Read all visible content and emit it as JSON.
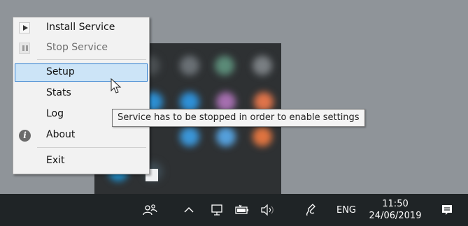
{
  "menu": {
    "items": [
      {
        "label": "Install Service",
        "icon": "play-icon",
        "enabled": true
      },
      {
        "label": "Stop Service",
        "icon": "pause-icon",
        "enabled": false
      },
      {
        "label": "Setup",
        "highlighted": true
      },
      {
        "label": "Stats"
      },
      {
        "label": "Log"
      },
      {
        "label": "About",
        "icon": "info-icon"
      },
      {
        "label": "Exit"
      }
    ]
  },
  "tooltip": {
    "text": "Service has to be stopped in order to enable settings"
  },
  "taskbar": {
    "icons": [
      "people-icon",
      "show-hidden-icons-chevron-icon",
      "network-icon",
      "battery-icon",
      "volume-icon",
      "pen-icon",
      "notification-icon"
    ],
    "language": "ENG",
    "time": "11:50",
    "date": "24/06/2019"
  },
  "colors": {
    "desktop": "#8f9499",
    "taskbar": "#1f2426",
    "highlight_bg": "#cce4f7",
    "highlight_border": "#2f7fd1"
  }
}
